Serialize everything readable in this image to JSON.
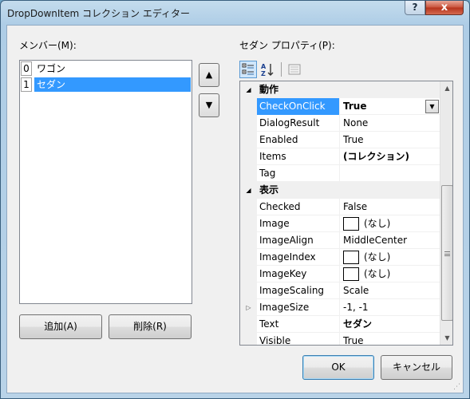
{
  "window": {
    "title": "DropDownItem コレクション エディター",
    "help_label": "?",
    "close_label": "x"
  },
  "members": {
    "label": "メンバー(M):",
    "items": [
      {
        "index": "0",
        "name": "ワゴン",
        "selected": false
      },
      {
        "index": "1",
        "name": "セダン",
        "selected": true
      }
    ],
    "move_up_label": "▲",
    "move_down_label": "▼",
    "add_label": "追加(A)",
    "remove_label": "削除(R)"
  },
  "properties": {
    "label": "セダン プロパティ(P):",
    "toolbar": {
      "categorized_icon": "categorized-icon",
      "alphabetical_icon": "alphabetical-icon",
      "property_pages_icon": "property-pages-icon"
    },
    "rows": [
      {
        "type": "category",
        "name": "動作",
        "expand": "◢"
      },
      {
        "type": "prop",
        "name": "CheckOnClick",
        "value": "True",
        "bold": true,
        "selected": true,
        "dropdown": true
      },
      {
        "type": "prop",
        "name": "DialogResult",
        "value": "None"
      },
      {
        "type": "prop",
        "name": "Enabled",
        "value": "True"
      },
      {
        "type": "prop",
        "name": "Items",
        "value": "(コレクション)",
        "bold": true
      },
      {
        "type": "prop",
        "name": "Tag",
        "value": ""
      },
      {
        "type": "category",
        "name": "表示",
        "expand": "◢"
      },
      {
        "type": "prop",
        "name": "Checked",
        "value": "False"
      },
      {
        "type": "prop",
        "name": "Image",
        "value": "(なし)",
        "swatch": true
      },
      {
        "type": "prop",
        "name": "ImageAlign",
        "value": "MiddleCenter"
      },
      {
        "type": "prop",
        "name": "ImageIndex",
        "value": "(なし)",
        "swatch": true
      },
      {
        "type": "prop",
        "name": "ImageKey",
        "value": "(なし)",
        "swatch": true
      },
      {
        "type": "prop",
        "name": "ImageScaling",
        "value": "Scale"
      },
      {
        "type": "prop",
        "name": "ImageSize",
        "value": "-1, -1",
        "expander": "▷"
      },
      {
        "type": "prop",
        "name": "Text",
        "value": "セダン",
        "bold": true
      },
      {
        "type": "prop",
        "name": "Visible",
        "value": "True"
      }
    ],
    "scroll_up": "▲",
    "scroll_down": "▼"
  },
  "footer": {
    "ok_label": "OK",
    "cancel_label": "キャンセル"
  },
  "colors": {
    "selection": "#3399ff",
    "client_bg": "#f0f0f0",
    "title_bar": "#aecde6",
    "close_button": "#c9513a"
  }
}
